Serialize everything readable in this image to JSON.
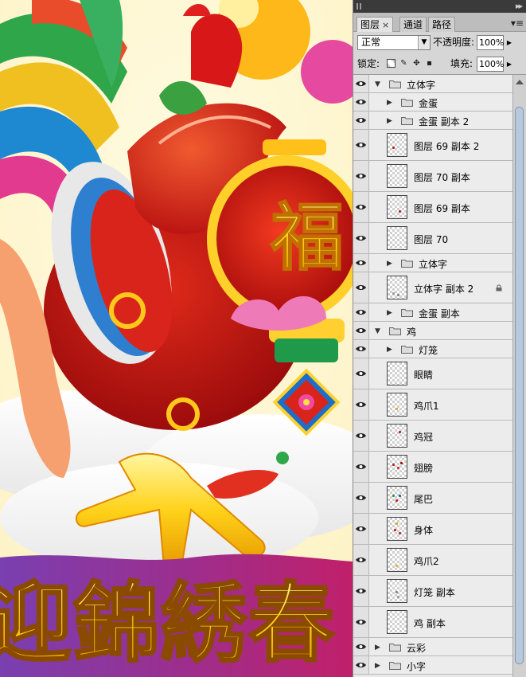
{
  "panel": {
    "tabs": [
      {
        "label": "图层",
        "close": "×",
        "active": true
      },
      {
        "label": "通道",
        "active": false
      },
      {
        "label": "路径",
        "active": false
      }
    ],
    "menu_icon": "panel-menu-icon",
    "blend_mode": "正常",
    "opacity_label": "不透明度:",
    "opacity_value": "100%",
    "lock_label": "锁定:",
    "fill_label": "填充:",
    "fill_value": "100%"
  },
  "layers": [
    {
      "name": "立体字",
      "kind": "group",
      "depth": 0,
      "expanded": true
    },
    {
      "name": "金蛋",
      "kind": "group",
      "depth": 1,
      "expanded": false
    },
    {
      "name": "金蛋 副本 2",
      "kind": "group",
      "depth": 1,
      "expanded": false
    },
    {
      "name": "图层 69 副本 2",
      "kind": "layer",
      "depth": 1
    },
    {
      "name": "图层 70 副本",
      "kind": "layer",
      "depth": 1
    },
    {
      "name": "图层 69 副本",
      "kind": "layer",
      "depth": 1
    },
    {
      "name": "图层 70",
      "kind": "layer",
      "depth": 1
    },
    {
      "name": "立体字",
      "kind": "group",
      "depth": 1,
      "expanded": false
    },
    {
      "name": "立体字 副本 2",
      "kind": "layer",
      "depth": 1,
      "locked": true
    },
    {
      "name": "金蛋 副本",
      "kind": "group",
      "depth": 1,
      "expanded": false
    },
    {
      "name": "鸡",
      "kind": "group",
      "depth": 0,
      "expanded": true
    },
    {
      "name": "灯笼",
      "kind": "group",
      "depth": 1,
      "expanded": false
    },
    {
      "name": "眼睛",
      "kind": "layer",
      "depth": 1
    },
    {
      "name": "鸡爪1",
      "kind": "layer",
      "depth": 1
    },
    {
      "name": "鸡冠",
      "kind": "layer",
      "depth": 1
    },
    {
      "name": "翅膀",
      "kind": "layer",
      "depth": 1
    },
    {
      "name": "尾巴",
      "kind": "layer",
      "depth": 1
    },
    {
      "name": "身体",
      "kind": "layer",
      "depth": 1
    },
    {
      "name": "鸡爪2",
      "kind": "layer",
      "depth": 1
    },
    {
      "name": "灯笼 副本",
      "kind": "layer",
      "depth": 1
    },
    {
      "name": "鸡 副本",
      "kind": "layer",
      "depth": 1
    },
    {
      "name": "云彩",
      "kind": "group",
      "depth": 0,
      "expanded": false
    },
    {
      "name": "小字",
      "kind": "group",
      "depth": 0,
      "expanded": false
    }
  ],
  "artwork": {
    "banner_text": "迎錦綉春",
    "lantern_text": "福"
  }
}
